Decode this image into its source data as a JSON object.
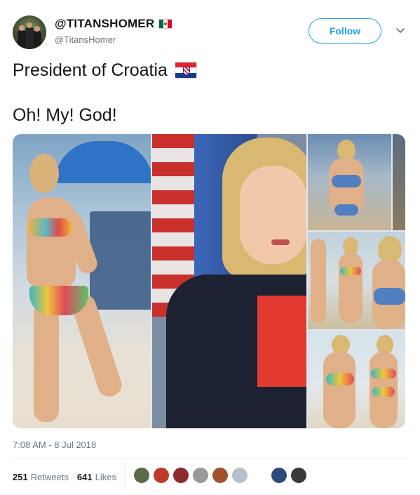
{
  "tweet": {
    "display_name": "@TITANSHOMER",
    "handle": "@TitansHomer",
    "follow_label": "Follow",
    "text_line1": "President of Croatia",
    "text_line2": "Oh! My! God!",
    "timestamp": "7:08 AM - 8 Jul 2018",
    "retweets_count": "251",
    "retweets_label": "Retweets",
    "likes_count": "641",
    "likes_label": "Likes"
  },
  "icons": {
    "name_flag": "mexico-flag-icon",
    "text_flag": "croatia-flag-icon",
    "menu": "chevron-down-icon"
  },
  "colors": {
    "accent": "#1da1f2",
    "text": "#14171a",
    "secondary": "#657786"
  },
  "liker_colors": [
    "#5a6b4a",
    "#c0392b",
    "#8e2b2b",
    "#9a9a9a",
    "#a0522d",
    "#b8c1c9",
    "#ffffff",
    "#2d4a7a",
    "#3a3a3a"
  ]
}
